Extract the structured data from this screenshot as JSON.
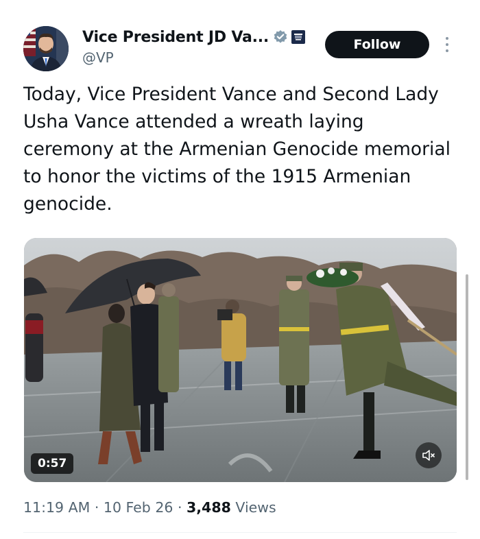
{
  "author": {
    "display_name": "Vice President JD Va...",
    "handle": "@VP",
    "avatar_icon": "profile-photo",
    "verified_icon": "verified-badge-icon",
    "affiliation_icon": "government-seal-icon",
    "verified_color": "#829aab"
  },
  "actions": {
    "follow_label": "Follow",
    "more_icon": "more-vertical-icon"
  },
  "tweet": {
    "text": "Today, Vice President Vance and Second Lady Usha Vance attended a wreath laying ceremony at the Armenian Genocide memorial to honor the victims of the 1915 Armenian genocide."
  },
  "media": {
    "type": "video",
    "duration": "0:57",
    "mute_icon": "speaker-muted-icon"
  },
  "meta": {
    "time": "11:19 AM",
    "date": "10 Feb 26",
    "separator": "·",
    "views_count": "3,488",
    "views_label": "Views"
  }
}
